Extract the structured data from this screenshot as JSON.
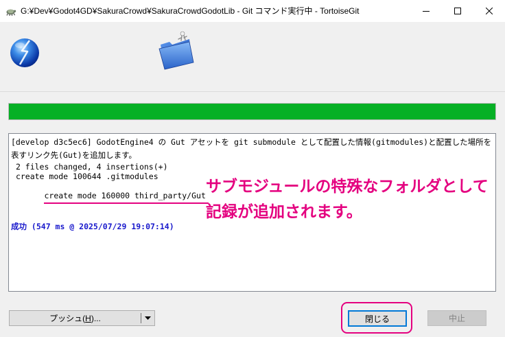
{
  "window": {
    "title": "G:¥Dev¥Godot4GD¥SakuraCrowd¥SakuraCrowdGodotLib - Git コマンド実行中 - TortoiseGit",
    "app_icon": "tortoisegit-icon",
    "controls": [
      "minimize-icon",
      "maximize-icon",
      "close-icon"
    ]
  },
  "header_icons": [
    "globe-icon",
    "folder-icon"
  ],
  "progress": {
    "fraction": 1.0
  },
  "log": {
    "lines": [
      {
        "text": "[develop d3c5ec6] GodotEngine4 の Gut アセットを git submodule として配置した情報(gitmodules)と配置した場所を表すリンク先(Gut)を追加します。"
      },
      {
        "text": " 2 files changed, 4 insertions(+)"
      },
      {
        "text": " create mode 100644 .gitmodules"
      },
      {
        "text": " create mode 160000 third_party/Gut"
      },
      {
        "text": "成功 (547 ms @ 2025/07/29 19:07:14)"
      }
    ]
  },
  "annotation": {
    "lines": [
      "サブモジュールの特殊なフォルダとして",
      "記録が追加されます。"
    ]
  },
  "buttons": {
    "push": {
      "label_pre": "プッシュ(",
      "label_accel": "H",
      "label_post": ")...",
      "dropdown_icon": "dropdown-arrow-icon"
    },
    "close": {
      "label": "閉じる",
      "focused": true
    },
    "abort": {
      "label": "中止",
      "enabled": false
    }
  },
  "colors": {
    "progress_fill": "#06b025",
    "success_text": "#1a1acc",
    "annotation": "#e4007f",
    "focus_border": "#0078d7"
  }
}
